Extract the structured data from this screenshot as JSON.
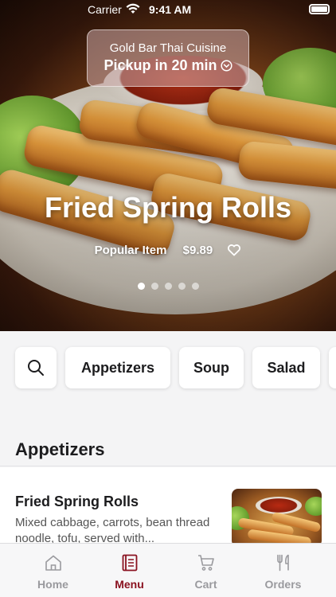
{
  "status_bar": {
    "carrier": "Carrier",
    "time": "9:41 AM"
  },
  "header": {
    "restaurant_name": "Gold Bar Thai Cuisine",
    "pickup_text": "Pickup in 20 min"
  },
  "hero": {
    "title": "Fried Spring Rolls",
    "tag": "Popular Item",
    "price": "$9.89",
    "carousel_count": 5,
    "active_index": 0
  },
  "categories": {
    "items": [
      "Appetizers",
      "Soup",
      "Salad"
    ]
  },
  "section": {
    "title": "Appetizers"
  },
  "menu_item": {
    "name": "Fried Spring Rolls",
    "description": "Mixed cabbage, carrots, bean thread noodle, tofu, served with..."
  },
  "tab_bar": {
    "tabs": [
      {
        "label": "Home",
        "icon": "home-icon"
      },
      {
        "label": "Menu",
        "icon": "menu-book-icon"
      },
      {
        "label": "Cart",
        "icon": "cart-icon"
      },
      {
        "label": "Orders",
        "icon": "fork-knife-icon"
      }
    ],
    "active": "Menu"
  },
  "colors": {
    "accent": "#8a1220",
    "inactive": "#9a9a9e"
  }
}
